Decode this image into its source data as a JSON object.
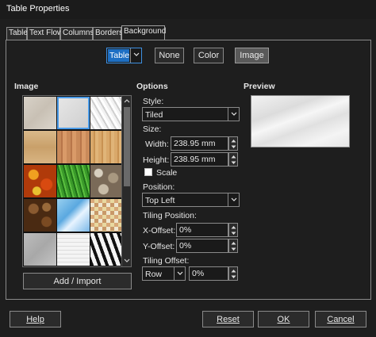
{
  "window": {
    "title": "Table Properties"
  },
  "tabs": [
    "Table",
    "Text Flow",
    "Columns",
    "Borders",
    "Background"
  ],
  "active_tab": "Background",
  "type": {
    "value": "Table",
    "buttons": [
      "None",
      "Color",
      "Image"
    ],
    "selected": "Image"
  },
  "image_section": {
    "heading": "Image",
    "add_import": "Add / Import"
  },
  "options": {
    "heading": "Options",
    "style_label": "Style:",
    "style_value": "Tiled",
    "size_label": "Size:",
    "width_label": "Width:",
    "width_value": "238.95 mm",
    "height_label": "Height:",
    "height_value": "238.95 mm",
    "scale_label": "Scale",
    "scale_checked": false,
    "position_label": "Position:",
    "position_value": "Top Left",
    "tiling_position_label": "Tiling Position:",
    "x_offset_label": "X-Offset:",
    "x_offset_value": "0%",
    "y_offset_label": "Y-Offset:",
    "y_offset_value": "0%",
    "tiling_offset_label": "Tiling Offset:",
    "tiling_offset_mode": "Row",
    "tiling_offset_value": "0%"
  },
  "preview": {
    "heading": "Preview"
  },
  "footer": {
    "help": "Help",
    "reset": "Reset",
    "ok": "OK",
    "cancel": "Cancel"
  },
  "colors": {
    "accent": "#1d6fc4",
    "background": "#1e1e1e",
    "selection": "#5a5a5a"
  }
}
